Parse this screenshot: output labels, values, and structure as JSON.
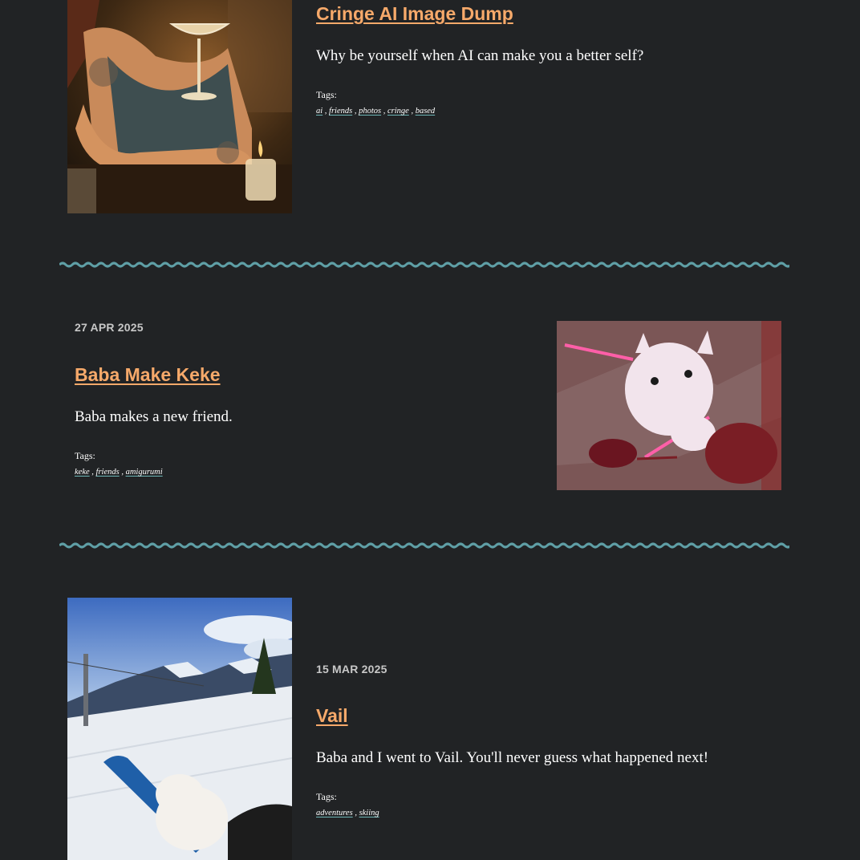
{
  "posts": [
    {
      "title": "Cringe AI Image Dump",
      "description": "Why be yourself when AI can make you a better self?",
      "tags_label": "Tags:",
      "tags": [
        "ai",
        "friends",
        "photos",
        "cringe",
        "based"
      ]
    },
    {
      "date": "27 APR 2025",
      "title": "Baba Make Keke",
      "description": "Baba makes a new friend.",
      "tags_label": "Tags:",
      "tags": [
        "keke",
        "friends",
        "amigurumi"
      ]
    },
    {
      "date": "15 MAR 2025",
      "title": "Vail",
      "description": "Baba and I went to Vail. You'll never guess what happened next!",
      "tags_label": "Tags:",
      "tags": [
        "adventures",
        "skiing"
      ]
    }
  ],
  "theme": {
    "background": "#212325",
    "title_color": "#f6a96a",
    "divider_color": "#5f9fa6",
    "date_color": "#c7c7c7"
  },
  "icons": [
    "wavy-divider"
  ]
}
